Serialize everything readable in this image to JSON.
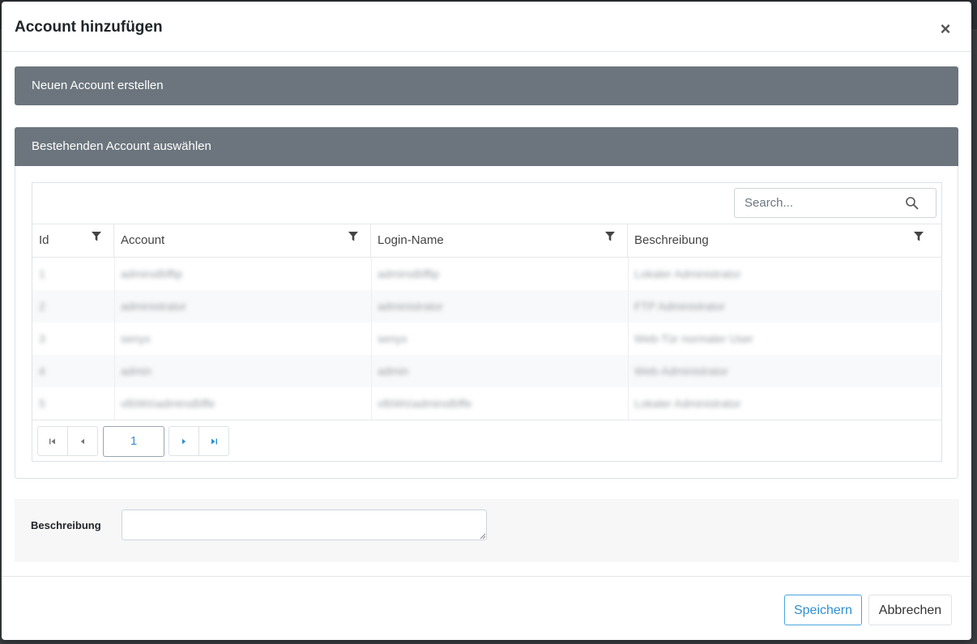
{
  "modal": {
    "title": "Account hinzufügen",
    "close_label": "×"
  },
  "panels": {
    "new_account": "Neuen Account erstellen",
    "existing_account": "Bestehenden Account auswählen"
  },
  "grid": {
    "search_placeholder": "Search...",
    "columns": [
      "Id",
      "Account",
      "Login-Name",
      "Beschreibung"
    ],
    "rows": [
      [
        "1",
        "adminsBiffip",
        "adminsBiffip",
        "Lokaler Administrator"
      ],
      [
        "2",
        "administrator",
        "administrator",
        "FTP Administrator"
      ],
      [
        "3",
        "senyx",
        "senyx",
        "Web-Tür normaler User"
      ],
      [
        "4",
        "admin",
        "admin",
        "Web-Administrator"
      ],
      [
        "5",
        "vBiWs\\adminsBiffe",
        "vBiWs\\adminsBiffe",
        "Lokaler Administrator"
      ]
    ],
    "pager": {
      "current_page": "1"
    }
  },
  "description": {
    "label": "Beschreibung",
    "value": ""
  },
  "footer": {
    "save_label": "Speichern",
    "cancel_label": "Abbrechen"
  },
  "colors": {
    "panel_bar": "#6c757d",
    "accent": "#2f8fd0",
    "link_icon": "#4aa5dc"
  }
}
